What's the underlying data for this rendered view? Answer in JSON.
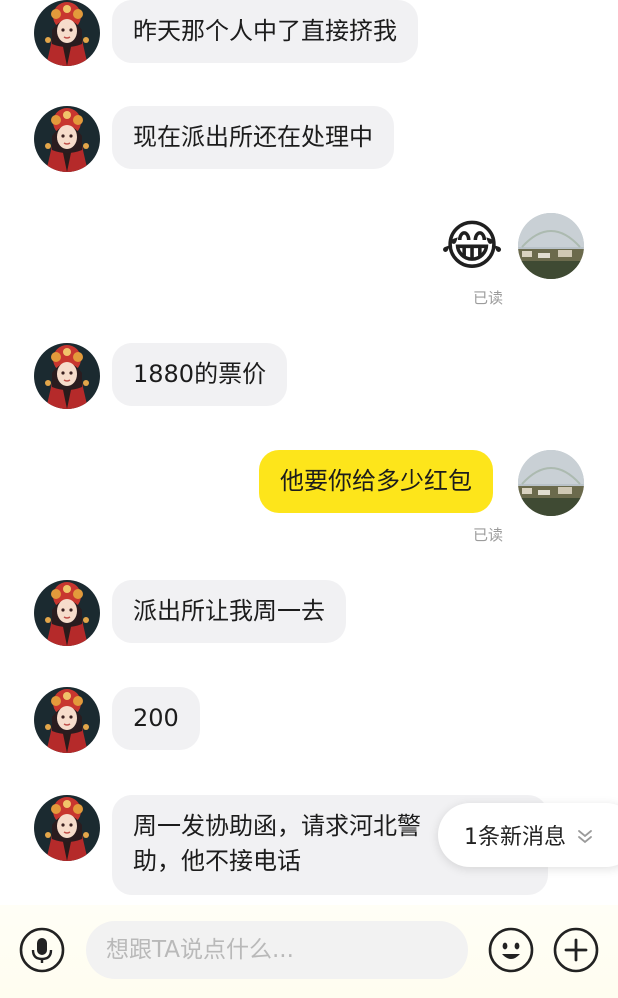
{
  "messages": [
    {
      "side": "in",
      "text": "昨天那个人中了直接挤我"
    },
    {
      "side": "in",
      "text": "现在派出所还在处理中"
    },
    {
      "side": "out",
      "type": "emoji",
      "emoji": "😂",
      "status": "已读"
    },
    {
      "side": "in",
      "text": "1880的票价"
    },
    {
      "side": "out",
      "text": "他要你给多少红包",
      "status": "已读"
    },
    {
      "side": "in",
      "text": "派出所让我周一去"
    },
    {
      "side": "in",
      "text": "200"
    },
    {
      "side": "in",
      "text": "周一发协助函，请求河北警",
      "text2": "助，他不接电话"
    }
  ],
  "new_message_pill": {
    "label": "1条新消息"
  },
  "input": {
    "placeholder": "想跟TA说点什么..."
  },
  "icons": {
    "voice": "microphone-icon",
    "emoji": "smiley-icon",
    "more": "plus-icon"
  },
  "colors": {
    "outgoing_bubble": "#fde51b",
    "incoming_bubble": "#f1f1f3"
  }
}
